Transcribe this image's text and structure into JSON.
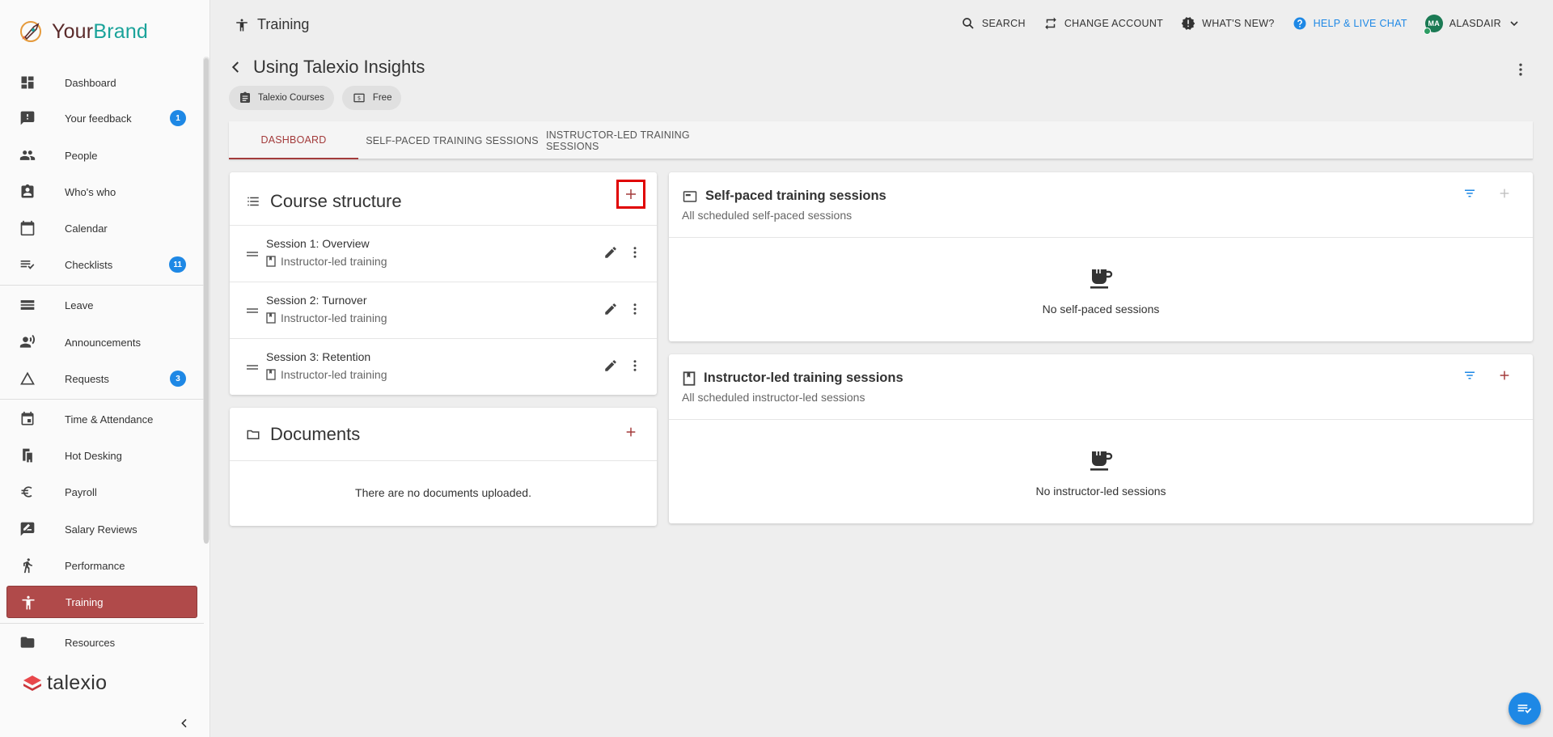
{
  "brand": {
    "part1": "Your",
    "part2": "Brand"
  },
  "footer_logo": "talexio",
  "sidebar": {
    "items": [
      {
        "label": "Dashboard",
        "icon": "dashboard-icon"
      },
      {
        "label": "Your feedback",
        "icon": "feedback-icon",
        "badge": "1"
      },
      {
        "label": "People",
        "icon": "people-icon"
      },
      {
        "label": "Who's who",
        "icon": "contact-badge-icon"
      },
      {
        "label": "Calendar",
        "icon": "calendar-icon"
      },
      {
        "label": "Checklists",
        "icon": "checklist-icon",
        "badge": "11"
      },
      {
        "label": "Leave",
        "icon": "leave-icon"
      },
      {
        "label": "Announcements",
        "icon": "announcement-icon"
      },
      {
        "label": "Requests",
        "icon": "requests-icon",
        "badge": "3"
      },
      {
        "label": "Time & Attendance",
        "icon": "time-attendance-icon"
      },
      {
        "label": "Hot Desking",
        "icon": "hot-desking-icon"
      },
      {
        "label": "Payroll",
        "icon": "euro-icon"
      },
      {
        "label": "Salary Reviews",
        "icon": "salary-review-icon"
      },
      {
        "label": "Performance",
        "icon": "performance-icon"
      },
      {
        "label": "Training",
        "icon": "training-icon",
        "active": true
      },
      {
        "label": "Resources",
        "icon": "folder-icon"
      }
    ]
  },
  "topbar": {
    "context_title": "Training",
    "search": "SEARCH",
    "change_account": "CHANGE ACCOUNT",
    "whats_new": "WHAT'S NEW?",
    "help": "HELP & LIVE CHAT",
    "avatar_initials": "MA",
    "user": "ALASDAIR"
  },
  "header": {
    "title": "Using Talexio Insights",
    "chips": [
      "Talexio Courses",
      "Free"
    ]
  },
  "tabs": [
    "DASHBOARD",
    "SELF-PACED TRAINING SESSIONS",
    "INSTRUCTOR-LED TRAINING SESSIONS"
  ],
  "course_structure": {
    "title": "Course structure",
    "sessions": [
      {
        "name": "Session 1: Overview",
        "type": "Instructor-led training"
      },
      {
        "name": "Session 2: Turnover",
        "type": "Instructor-led training"
      },
      {
        "name": "Session 3: Retention",
        "type": "Instructor-led training"
      }
    ]
  },
  "documents": {
    "title": "Documents",
    "empty": "There are no documents uploaded."
  },
  "self_paced": {
    "title": "Self-paced training sessions",
    "subtitle": "All scheduled self-paced sessions",
    "empty": "No self-paced sessions"
  },
  "instructor_led": {
    "title": "Instructor-led training sessions",
    "subtitle": "All scheduled instructor-led sessions",
    "empty": "No instructor-led sessions"
  },
  "colors": {
    "accent": "#a33b3b",
    "active_nav": "#b04a4a",
    "link_blue": "#1e88e5",
    "brand_teal": "#1aa39a",
    "highlight_box": "#e00000"
  }
}
